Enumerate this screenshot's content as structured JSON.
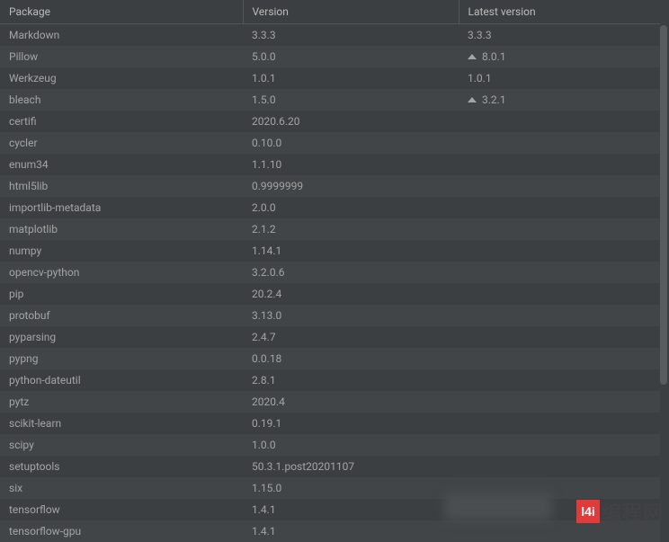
{
  "columns": {
    "package": "Package",
    "version": "Version",
    "latest": "Latest version"
  },
  "packages": [
    {
      "name": "Markdown",
      "version": "3.3.3",
      "latest": "3.3.3",
      "upgrade": false
    },
    {
      "name": "Pillow",
      "version": "5.0.0",
      "latest": "8.0.1",
      "upgrade": true
    },
    {
      "name": "Werkzeug",
      "version": "1.0.1",
      "latest": "1.0.1",
      "upgrade": false
    },
    {
      "name": "bleach",
      "version": "1.5.0",
      "latest": "3.2.1",
      "upgrade": true
    },
    {
      "name": "certifi",
      "version": "2020.6.20",
      "latest": "",
      "upgrade": false
    },
    {
      "name": "cycler",
      "version": "0.10.0",
      "latest": "",
      "upgrade": false
    },
    {
      "name": "enum34",
      "version": "1.1.10",
      "latest": "",
      "upgrade": false
    },
    {
      "name": "html5lib",
      "version": "0.9999999",
      "latest": "",
      "upgrade": false
    },
    {
      "name": "importlib-metadata",
      "version": "2.0.0",
      "latest": "",
      "upgrade": false
    },
    {
      "name": "matplotlib",
      "version": "2.1.2",
      "latest": "",
      "upgrade": false
    },
    {
      "name": "numpy",
      "version": "1.14.1",
      "latest": "",
      "upgrade": false
    },
    {
      "name": "opencv-python",
      "version": "3.2.0.6",
      "latest": "",
      "upgrade": false
    },
    {
      "name": "pip",
      "version": "20.2.4",
      "latest": "",
      "upgrade": false
    },
    {
      "name": "protobuf",
      "version": "3.13.0",
      "latest": "",
      "upgrade": false
    },
    {
      "name": "pyparsing",
      "version": "2.4.7",
      "latest": "",
      "upgrade": false
    },
    {
      "name": "pypng",
      "version": "0.0.18",
      "latest": "",
      "upgrade": false
    },
    {
      "name": "python-dateutil",
      "version": "2.8.1",
      "latest": "",
      "upgrade": false
    },
    {
      "name": "pytz",
      "version": "2020.4",
      "latest": "",
      "upgrade": false
    },
    {
      "name": "scikit-learn",
      "version": "0.19.1",
      "latest": "",
      "upgrade": false
    },
    {
      "name": "scipy",
      "version": "1.0.0",
      "latest": "",
      "upgrade": false
    },
    {
      "name": "setuptools",
      "version": "50.3.1.post20201107",
      "latest": "",
      "upgrade": false
    },
    {
      "name": "six",
      "version": "1.15.0",
      "latest": "",
      "upgrade": false
    },
    {
      "name": "tensorflow",
      "version": "1.4.1",
      "latest": "",
      "upgrade": false
    },
    {
      "name": "tensorflow-gpu",
      "version": "1.4.1",
      "latest": "",
      "upgrade": false
    }
  ],
  "watermark": {
    "logo": "l4i",
    "text": "编程网"
  }
}
